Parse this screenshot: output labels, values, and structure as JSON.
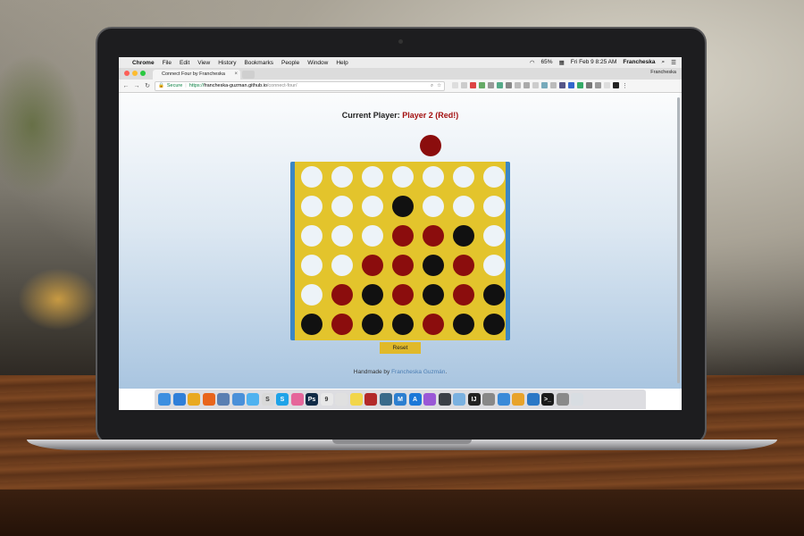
{
  "menubar": {
    "app": "Chrome",
    "items": [
      "File",
      "Edit",
      "View",
      "History",
      "Bookmarks",
      "People",
      "Window",
      "Help"
    ],
    "battery": "65%",
    "clock": "Fri Feb 9  8:25 AM",
    "user": "Francheska"
  },
  "browser": {
    "tab_title": "Connect Four by Francheska",
    "profile": "Francheska",
    "secure_label": "Secure",
    "url_scheme": "https://",
    "url_host": "francheska-guzman.github.io",
    "url_path": "/connect-four/"
  },
  "game": {
    "status_prefix": "Current Player:",
    "current_player": "Player 2 (Red!)",
    "reset_label": "Reset",
    "footer_prefix": "Handmade by ",
    "footer_author": "Francheska Guzmán",
    "footer_suffix": ".",
    "colors": {
      "red": "#8b0d0d",
      "black": "#111111",
      "empty": "#edf3f8",
      "board": "#e3c42c",
      "board_edge": "#3b86c4"
    },
    "board": [
      [
        "empty",
        "empty",
        "empty",
        "empty",
        "empty",
        "empty",
        "empty"
      ],
      [
        "empty",
        "empty",
        "empty",
        "black",
        "empty",
        "empty",
        "empty"
      ],
      [
        "empty",
        "empty",
        "empty",
        "red",
        "red",
        "black",
        "empty"
      ],
      [
        "empty",
        "empty",
        "red",
        "red",
        "black",
        "red",
        "empty"
      ],
      [
        "empty",
        "red",
        "black",
        "red",
        "black",
        "red",
        "black"
      ],
      [
        "black",
        "red",
        "black",
        "black",
        "red",
        "black",
        "black"
      ]
    ]
  },
  "dock": {
    "icons": [
      {
        "name": "finder-icon",
        "color": "#3d8fe0",
        "glyph": ""
      },
      {
        "name": "safari-icon",
        "color": "#2f7fd9",
        "glyph": ""
      },
      {
        "name": "chrome-icon",
        "color": "#e9a920",
        "glyph": ""
      },
      {
        "name": "firefox-icon",
        "color": "#e8651c",
        "glyph": ""
      },
      {
        "name": "preview-icon",
        "color": "#5a7fb2",
        "glyph": ""
      },
      {
        "name": "mail-icon",
        "color": "#4a90d9",
        "glyph": ""
      },
      {
        "name": "messages-icon",
        "color": "#4fb2f0",
        "glyph": ""
      },
      {
        "name": "slack-icon",
        "color": "#d9d9d9",
        "glyph": "S"
      },
      {
        "name": "skype-icon",
        "color": "#1fa3e8",
        "glyph": "S"
      },
      {
        "name": "photos-icon",
        "color": "#e5669a",
        "glyph": ""
      },
      {
        "name": "photoshop-icon",
        "color": "#102a46",
        "glyph": "Ps"
      },
      {
        "name": "calendar-icon",
        "color": "#e8e8e8",
        "glyph": "9"
      },
      {
        "name": "notes-icon",
        "color": "#e0e0e0",
        "glyph": ""
      },
      {
        "name": "stickies-icon",
        "color": "#f2d64b",
        "glyph": ""
      },
      {
        "name": "acrobat-icon",
        "color": "#b32a2a",
        "glyph": ""
      },
      {
        "name": "quicktime-icon",
        "color": "#3a6a8a",
        "glyph": ""
      },
      {
        "name": "mindnode-icon",
        "color": "#2d7fd0",
        "glyph": "M"
      },
      {
        "name": "appstore-icon",
        "color": "#1c78d8",
        "glyph": "A"
      },
      {
        "name": "itunes-icon",
        "color": "#9a57d6",
        "glyph": ""
      },
      {
        "name": "sublime-icon",
        "color": "#3a3f47",
        "glyph": ""
      },
      {
        "name": "virtualbox-icon",
        "color": "#7ab1e0",
        "glyph": ""
      },
      {
        "name": "intellij-icon",
        "color": "#222222",
        "glyph": "IJ"
      },
      {
        "name": "alfred-icon",
        "color": "#888888",
        "glyph": ""
      },
      {
        "name": "xcode-icon",
        "color": "#3a8ad8",
        "glyph": ""
      },
      {
        "name": "sketch-icon",
        "color": "#e8a32a",
        "glyph": ""
      },
      {
        "name": "visual-studio-code-icon",
        "color": "#2b78c6",
        "glyph": ""
      },
      {
        "name": "terminal-icon",
        "color": "#1a1a1a",
        "glyph": ">_"
      },
      {
        "name": "system-preferences-icon",
        "color": "#8a8a8a",
        "glyph": ""
      },
      {
        "name": "trash-icon",
        "color": "#d8dde2",
        "glyph": ""
      }
    ]
  }
}
